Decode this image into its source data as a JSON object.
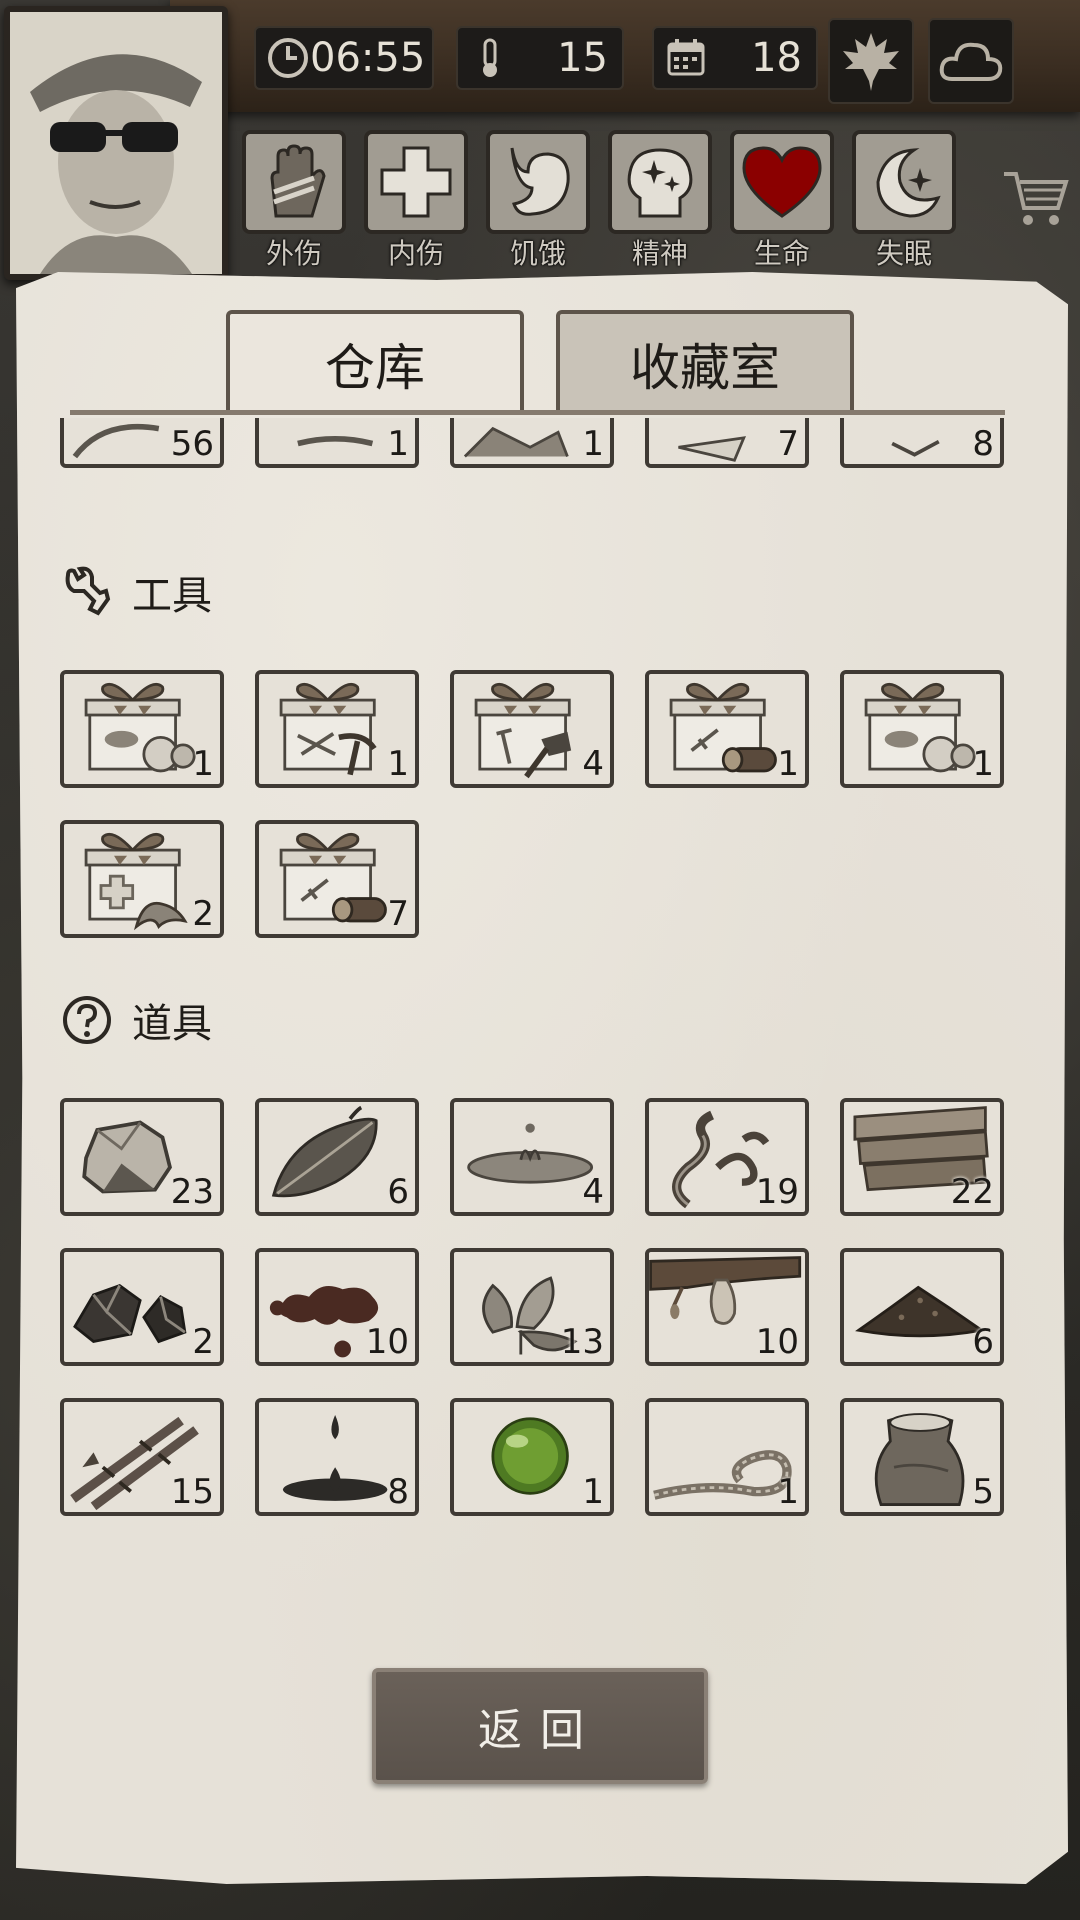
{
  "hud": {
    "time": "06:55",
    "temperature": "15",
    "day": "18",
    "season_icon": "maple-leaf-icon",
    "weather_icon": "cloud-icon"
  },
  "status": [
    {
      "label": "外伤",
      "icon": "bandaged-hand-icon"
    },
    {
      "label": "内伤",
      "icon": "cross-icon"
    },
    {
      "label": "饥饿",
      "icon": "stomach-icon"
    },
    {
      "label": "精神",
      "icon": "head-sparkle-icon"
    },
    {
      "label": "生命",
      "icon": "heart-icon"
    },
    {
      "label": "失眠",
      "icon": "moon-star-icon"
    }
  ],
  "tabs": {
    "warehouse": "仓库",
    "collection": "收藏室"
  },
  "partial_row": [
    "56",
    "1",
    "1",
    "7",
    "8"
  ],
  "sections": {
    "tools": {
      "title": "工具",
      "icon": "wrench-icon",
      "items": [
        {
          "icon": "gift-box-food-icon",
          "count": "1"
        },
        {
          "icon": "gift-box-pickaxe-icon",
          "count": "1"
        },
        {
          "icon": "gift-box-axe-icon",
          "count": "4"
        },
        {
          "icon": "gift-box-log-icon",
          "count": "1"
        },
        {
          "icon": "gift-box-food-icon",
          "count": "1"
        },
        {
          "icon": "gift-box-medical-icon",
          "count": "2"
        },
        {
          "icon": "gift-box-log-icon",
          "count": "7"
        }
      ]
    },
    "props": {
      "title": "道具",
      "icon": "question-icon",
      "items": [
        {
          "icon": "stone-icon",
          "count": "23"
        },
        {
          "icon": "leaf-icon",
          "count": "6"
        },
        {
          "icon": "water-puddle-icon",
          "count": "4"
        },
        {
          "icon": "vine-icon",
          "count": "19"
        },
        {
          "icon": "wood-planks-icon",
          "count": "22"
        },
        {
          "icon": "ore-icon",
          "count": "2"
        },
        {
          "icon": "blood-icon",
          "count": "10"
        },
        {
          "icon": "herb-icon",
          "count": "13"
        },
        {
          "icon": "resin-icon",
          "count": "10"
        },
        {
          "icon": "soil-icon",
          "count": "6"
        },
        {
          "icon": "bamboo-icon",
          "count": "15"
        },
        {
          "icon": "oil-drop-icon",
          "count": "8"
        },
        {
          "icon": "green-orb-icon",
          "count": "1"
        },
        {
          "icon": "rope-icon",
          "count": "1"
        },
        {
          "icon": "grain-sack-icon",
          "count": "5"
        }
      ]
    }
  },
  "back_button": "返回",
  "colors": {
    "paper": "#e6e1d8",
    "heart": "#8b0000",
    "frame": "#3f3a34"
  }
}
